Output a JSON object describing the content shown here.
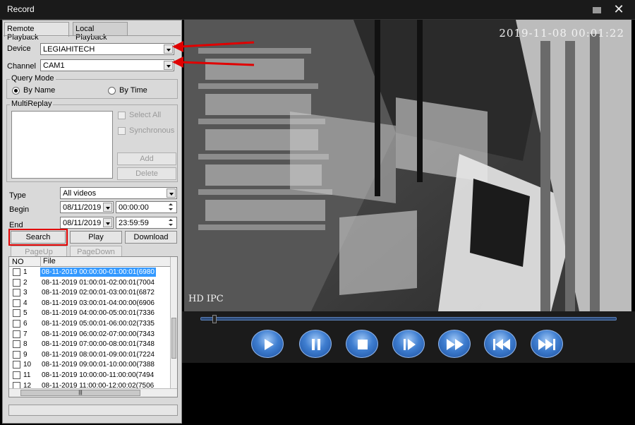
{
  "window": {
    "title": "Record",
    "close_glyph": "✕"
  },
  "tabs": [
    {
      "label": "Remote Playback",
      "active": true
    },
    {
      "label": "Local Playback",
      "active": false
    }
  ],
  "form": {
    "device_label": "Device",
    "device_value": "LEGIAHITECH",
    "channel_label": "Channel",
    "channel_value": "CAM1",
    "query_mode_label": "Query Mode",
    "by_name_label": "By Name",
    "by_time_label": "By Time",
    "by_name_selected": true,
    "multireplay_label": "MultiReplay",
    "select_all_label": "Select All",
    "synchronous_label": "Synchronous",
    "add_label": "Add",
    "delete_label": "Delete",
    "type_label": "Type",
    "type_value": "All videos",
    "begin_label": "Begin",
    "begin_date": "08/11/2019",
    "begin_time": "00:00:00",
    "end_label": "End",
    "end_date": "08/11/2019",
    "end_time": "23:59:59"
  },
  "actions": {
    "search_label": "Search",
    "play_label": "Play",
    "download_label": "Download",
    "pageup_label": "PageUp",
    "pagedown_label": "PageDown"
  },
  "file_list": {
    "col_no": "NO",
    "col_file": "File",
    "hscroll_glyph": "|||",
    "rows": [
      {
        "no": "1",
        "file": "08-11-2019 00:00:00-01:00:01(6980",
        "selected": true
      },
      {
        "no": "2",
        "file": "08-11-2019 01:00:01-02:00:01(7004",
        "selected": false
      },
      {
        "no": "3",
        "file": "08-11-2019 02:00:01-03:00:01(6872",
        "selected": false
      },
      {
        "no": "4",
        "file": "08-11-2019 03:00:01-04:00:00(6906",
        "selected": false
      },
      {
        "no": "5",
        "file": "08-11-2019 04:00:00-05:00:01(7336",
        "selected": false
      },
      {
        "no": "6",
        "file": "08-11-2019 05:00:01-06:00:02(7335",
        "selected": false
      },
      {
        "no": "7",
        "file": "08-11-2019 06:00:02-07:00:00(7343",
        "selected": false
      },
      {
        "no": "8",
        "file": "08-11-2019 07:00:00-08:00:01(7348",
        "selected": false
      },
      {
        "no": "9",
        "file": "08-11-2019 08:00:01-09:00:01(7224",
        "selected": false
      },
      {
        "no": "10",
        "file": "08-11-2019 09:00:01-10:00:00(7388",
        "selected": false
      },
      {
        "no": "11",
        "file": "08-11-2019 10:00:00-11:00:00(7494",
        "selected": false
      },
      {
        "no": "12",
        "file": "08-11-2019 11:00:00-12:00:02(7506",
        "selected": false
      }
    ]
  },
  "video": {
    "timestamp": "2019-11-08 00:01:22",
    "overlay": "HD IPC"
  },
  "controls": {
    "buttons": [
      "play-icon",
      "pause-icon",
      "stop-icon",
      "step-forward-icon",
      "fast-forward-icon",
      "skip-back-icon",
      "skip-forward-icon"
    ]
  },
  "colors": {
    "accent_blue": "#3399ff",
    "annotation_red": "#e00000",
    "button_blue": "#3f7ed0"
  }
}
